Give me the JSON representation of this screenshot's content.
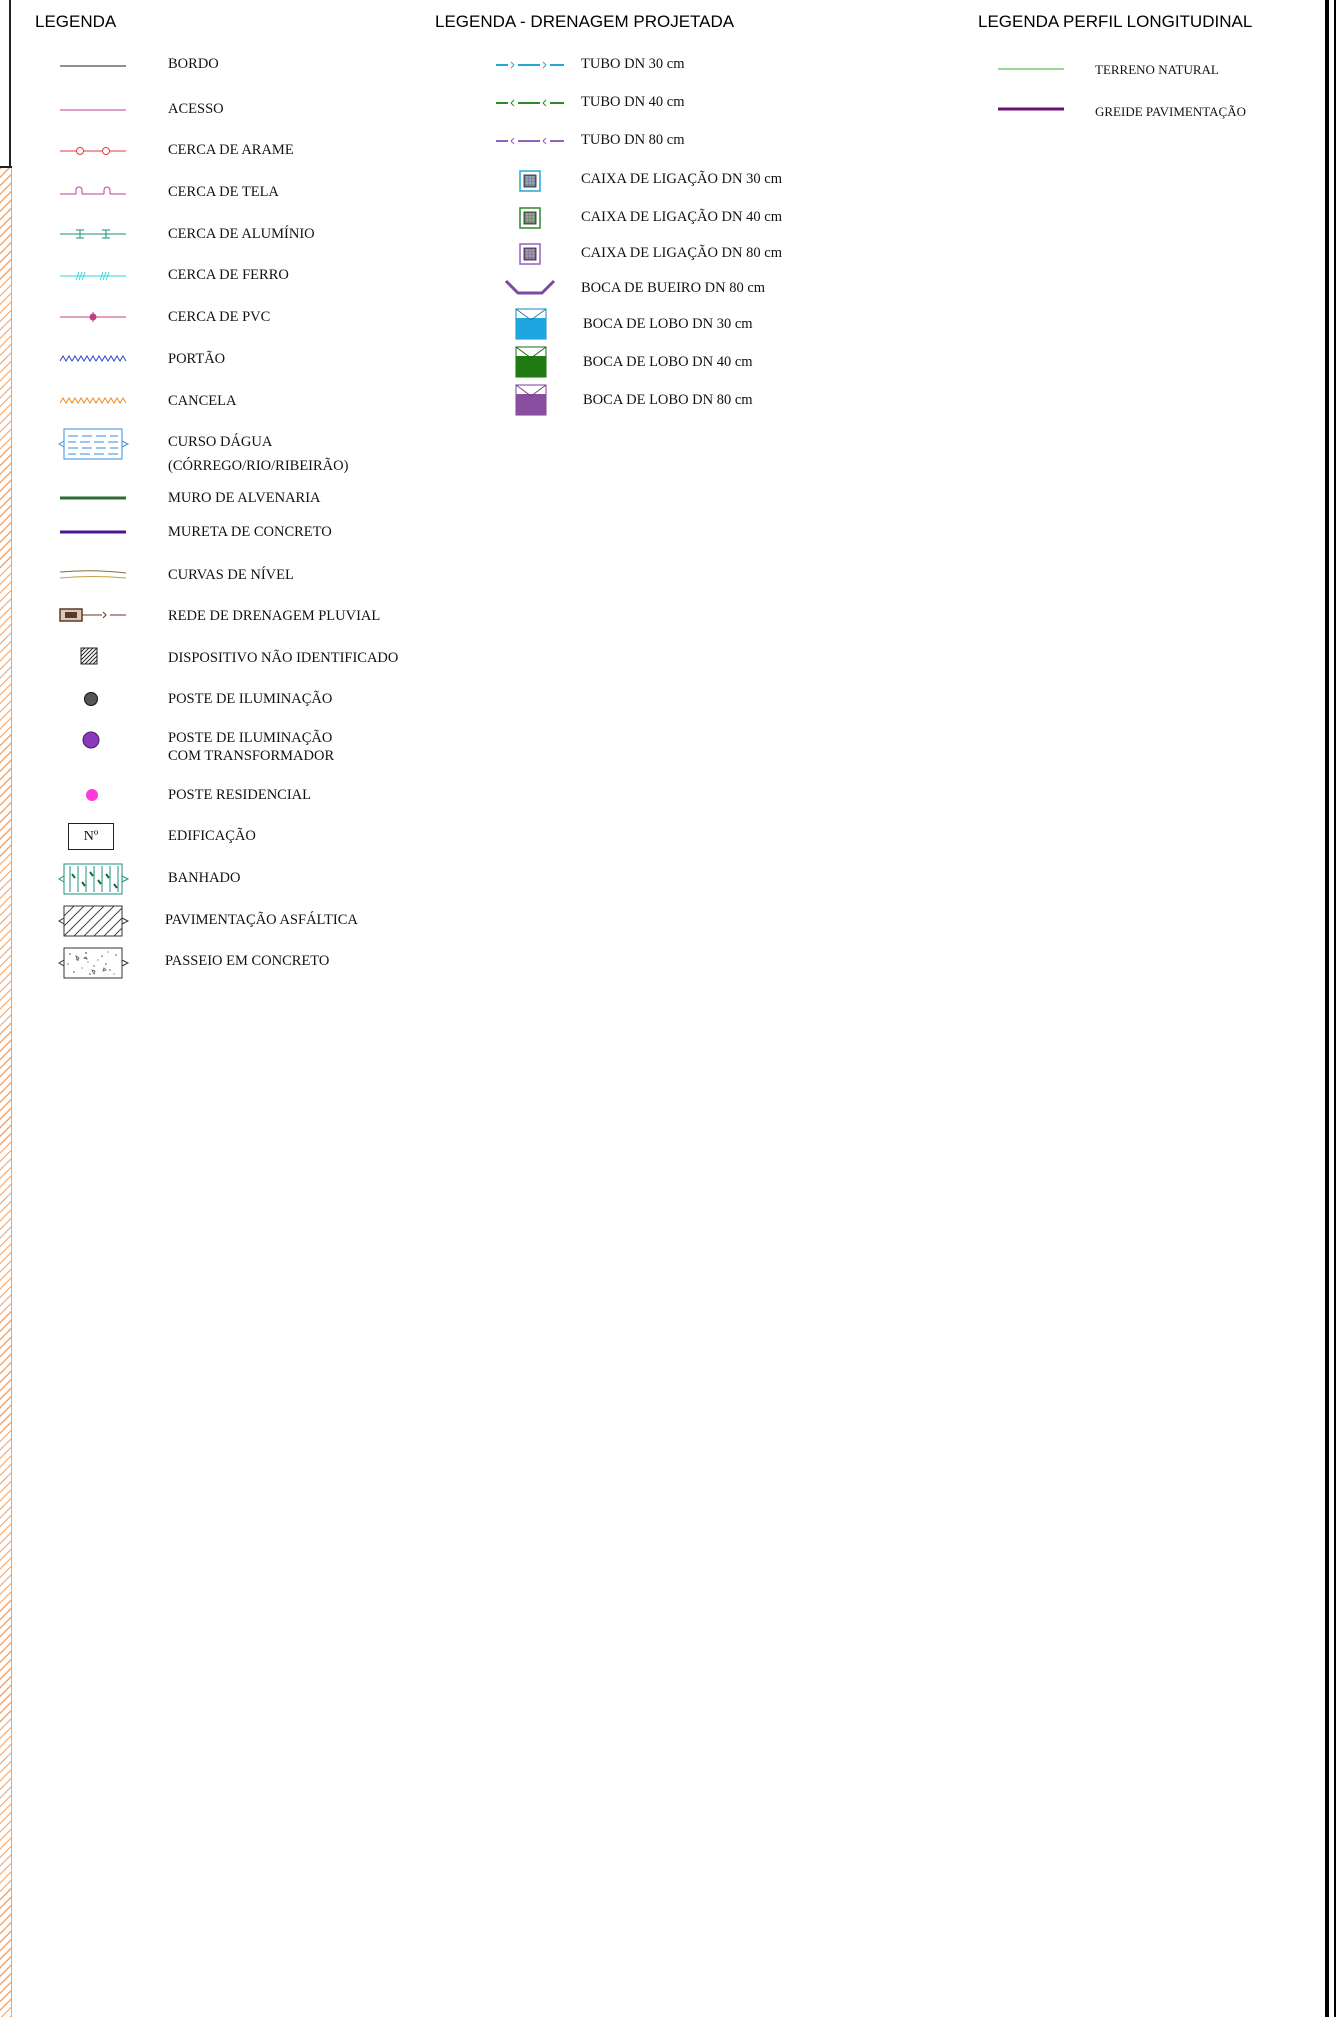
{
  "legend_general": {
    "title": "LEGENDA",
    "items": [
      {
        "symbol": "line-black",
        "label": "BORDO"
      },
      {
        "symbol": "line-magenta",
        "label": "ACESSO"
      },
      {
        "symbol": "fence-wire",
        "label": "CERCA DE ARAME"
      },
      {
        "symbol": "fence-screen",
        "label": "CERCA DE TELA"
      },
      {
        "symbol": "fence-aluminum",
        "label": "CERCA DE ALUMÍNIO"
      },
      {
        "symbol": "fence-iron",
        "label": "CERCA DE FERRO"
      },
      {
        "symbol": "fence-pvc",
        "label": "CERCA DE PVC"
      },
      {
        "symbol": "gate-zigzag",
        "label": "PORTÃO"
      },
      {
        "symbol": "barrier-zigzag",
        "label": "CANCELA"
      },
      {
        "symbol": "watercourse",
        "label": "CURSO DÁGUA",
        "label2": "(CÓRREGO/RIO/RIBEIRÃO)"
      },
      {
        "symbol": "wall-masonry",
        "label": "MURO DE ALVENARIA"
      },
      {
        "symbol": "wall-concrete",
        "label": "MURETA DE CONCRETO"
      },
      {
        "symbol": "contour-lines",
        "label": "CURVAS DE NÍVEL"
      },
      {
        "symbol": "storm-drain",
        "label": "REDE DE DRENAGEM PLUVIAL"
      },
      {
        "symbol": "unknown-device",
        "label": "DISPOSITIVO NÃO IDENTIFICADO"
      },
      {
        "symbol": "light-pole",
        "label": "POSTE DE ILUMINAÇÃO"
      },
      {
        "symbol": "light-pole-transformer",
        "label": "POSTE DE ILUMINAÇÃO",
        "label2": "COM TRANSFORMADOR"
      },
      {
        "symbol": "residential-pole",
        "label": "POSTE RESIDENCIAL"
      },
      {
        "symbol": "building",
        "label": "EDIFICAÇÃO",
        "symbol_text": "Nº"
      },
      {
        "symbol": "wetland",
        "label": "BANHADO"
      },
      {
        "symbol": "asphalt",
        "label": "PAVIMENTAÇÃO ASFÁLTICA"
      },
      {
        "symbol": "concrete-sidewalk",
        "label": "PASSEIO EM CONCRETO"
      }
    ]
  },
  "legend_drainage": {
    "title": "LEGENDA - DRENAGEM PROJETADA",
    "items": [
      {
        "symbol": "pipe-30",
        "label": "TUBO DN 30 cm"
      },
      {
        "symbol": "pipe-40",
        "label": "TUBO DN 40 cm"
      },
      {
        "symbol": "pipe-80",
        "label": "TUBO DN 80 cm"
      },
      {
        "symbol": "box-30",
        "label": "CAIXA DE LIGAÇÃO DN 30 cm"
      },
      {
        "symbol": "box-40",
        "label": "CAIXA DE LIGAÇÃO DN 40 cm"
      },
      {
        "symbol": "box-80",
        "label": "CAIXA DE LIGAÇÃO DN 80 cm"
      },
      {
        "symbol": "culvert-mouth-80",
        "label": "BOCA DE BUEIRO DN 80 cm"
      },
      {
        "symbol": "inlet-30",
        "label": "BOCA DE LOBO DN 30 cm"
      },
      {
        "symbol": "inlet-40",
        "label": "BOCA DE LOBO DN 40 cm"
      },
      {
        "symbol": "inlet-80",
        "label": "BOCA DE LOBO DN 80 cm"
      }
    ]
  },
  "legend_profile": {
    "title": "LEGENDA PERFIL LONGITUDINAL",
    "items": [
      {
        "symbol": "natural-terrain",
        "label": "TERRENO NATURAL"
      },
      {
        "symbol": "paving-grade",
        "label": "GREIDE PAVIMENTAÇÃO"
      }
    ]
  },
  "colors": {
    "black": "#222222",
    "magenta": "#c0389c",
    "red": "#e23a3a",
    "teal": "#1a8f7a",
    "cyan": "#35d6d6",
    "pvc": "#c0407e",
    "blue": "#2e48c8",
    "orange": "#f08a24",
    "water": "#3a8ee0",
    "wall_green": "#2e6b36",
    "wall_purple": "#4a1590",
    "contour": "#a08a40",
    "drain_brown": "#5a3a28",
    "pipe30": "#22a8d8",
    "pipe40": "#2a8a2a",
    "pipe80": "#9a5cc0",
    "culvert": "#7a4a9c",
    "inlet30": "#1ea6e0",
    "inlet40": "#1f7a12",
    "inlet80": "#8a4ea0",
    "terrain": "#5ac25a",
    "grade": "#6a1070",
    "pink_pole": "#ff3ad8",
    "purple_pole": "#8a3ab8"
  }
}
